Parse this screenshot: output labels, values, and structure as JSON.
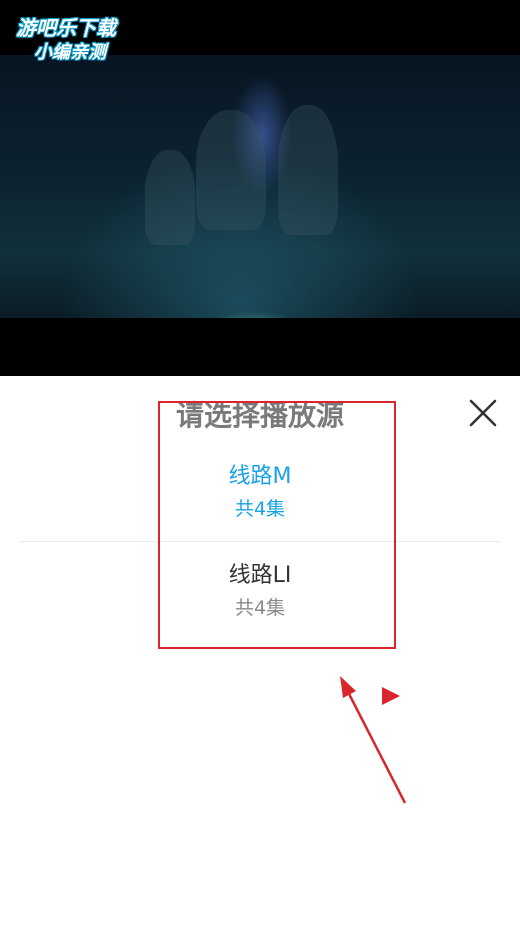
{
  "watermark": {
    "line1": "游吧乐下载",
    "line2": "小编亲测"
  },
  "sheet": {
    "title": "请选择播放源",
    "close_icon": "close-icon"
  },
  "sources": [
    {
      "name": "线路M",
      "count": "共4集",
      "selected": true
    },
    {
      "name": "线路LI",
      "count": "共4集",
      "selected": false
    }
  ],
  "colors": {
    "accent": "#1aa3e8",
    "title": "#7a7a7a",
    "annotation": "#d9262c"
  }
}
